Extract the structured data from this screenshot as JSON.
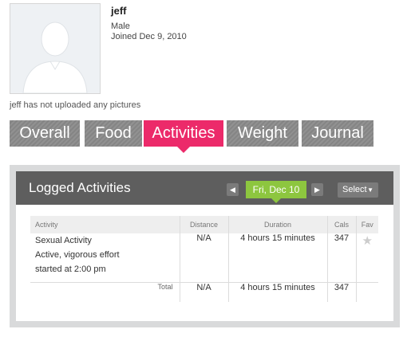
{
  "profile": {
    "name": "jeff",
    "gender": "Male",
    "joined": "Joined Dec 9, 2010",
    "no_pictures": "jeff has not uploaded any pictures"
  },
  "tabs": [
    {
      "label": "Overall",
      "active": false
    },
    {
      "label": "Food",
      "active": false
    },
    {
      "label": "Activities",
      "active": true
    },
    {
      "label": "Weight",
      "active": false
    },
    {
      "label": "Journal",
      "active": false
    }
  ],
  "colors": {
    "tab_active": "#ec2a6a",
    "tab_inactive": "#8a8a8a",
    "date_pill": "#8dc63f",
    "panel_header": "#5e5e5e"
  },
  "panel": {
    "title": "Logged Activities",
    "prev_icon": "chevron-left-icon",
    "next_icon": "chevron-right-icon",
    "date": "Fri, Dec 10",
    "select_label": "Select"
  },
  "table": {
    "headers": {
      "activity": "Activity",
      "distance": "Distance",
      "duration": "Duration",
      "cals": "Cals",
      "fav": "Fav"
    },
    "rows": [
      {
        "activity_name": "Sexual Activity",
        "activity_detail": "Active, vigorous effort",
        "activity_time": "started at 2:00 pm",
        "distance": "N/A",
        "duration": "4 hours 15 minutes",
        "cals": "347",
        "fav_icon": "star-icon"
      }
    ],
    "total": {
      "label": "Total",
      "distance": "N/A",
      "duration": "4 hours 15 minutes",
      "cals": "347"
    }
  }
}
